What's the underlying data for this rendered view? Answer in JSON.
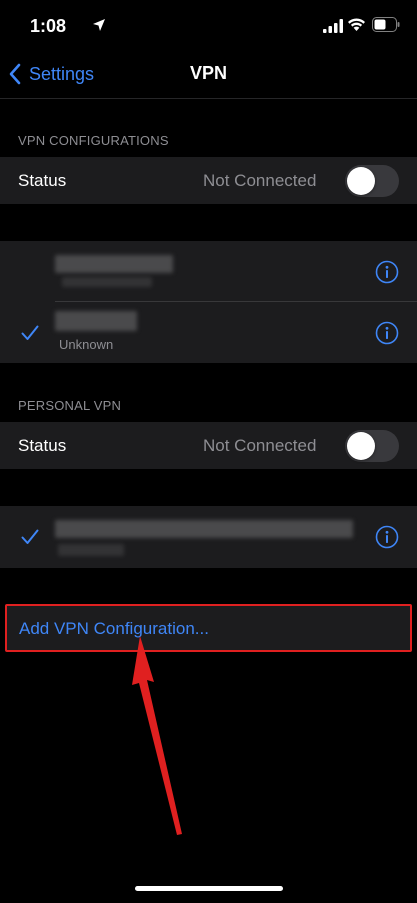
{
  "status_bar": {
    "time": "1:08"
  },
  "nav": {
    "back_label": "Settings",
    "title": "VPN"
  },
  "vpn_configurations": {
    "header": "VPN CONFIGURATIONS",
    "status_label": "Status",
    "status_value": "Not Connected",
    "connection_sublabel": "Unknown"
  },
  "personal_vpn": {
    "header": "PERSONAL VPN",
    "status_label": "Status",
    "status_value": "Not Connected"
  },
  "add_vpn_label": "Add VPN Configuration...",
  "colors": {
    "accent": "#3f86f7",
    "background": "#000000",
    "cell": "#1c1c1e",
    "secondary_text": "#8e8e93",
    "annotation": "#e02020"
  },
  "icons": [
    "location-arrow-icon",
    "signal-icon",
    "wifi-icon",
    "battery-icon",
    "chevron-left-icon",
    "info-icon",
    "checkmark-icon"
  ]
}
